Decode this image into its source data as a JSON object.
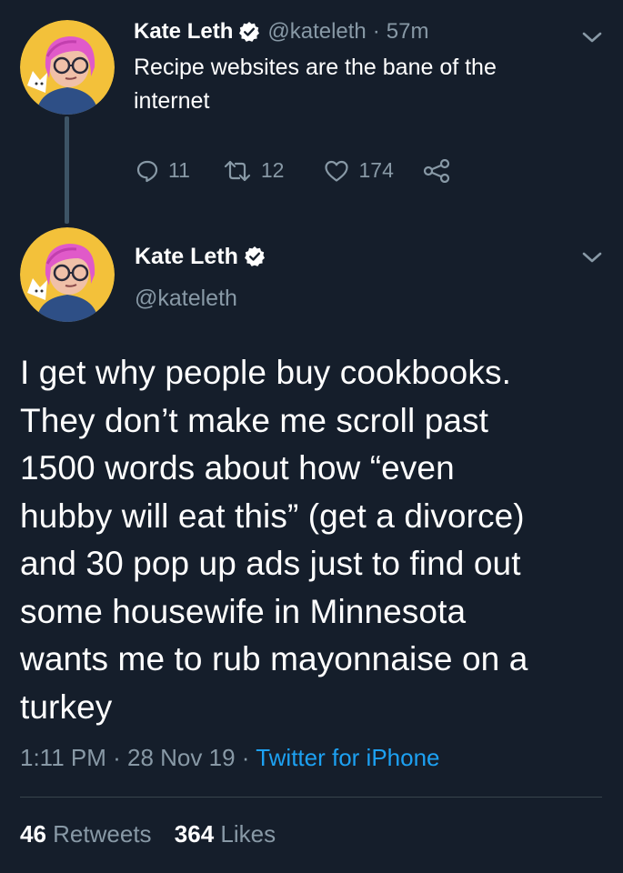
{
  "colors": {
    "background": "#151e2b",
    "text": "#ffffff",
    "muted": "#8899a6",
    "link": "#1da1f2",
    "verified": "#ffffff"
  },
  "tweet1": {
    "name": "Kate Leth",
    "handle": "@kateleth",
    "separator": "·",
    "time": "57m",
    "text_lines": [
      "Recipe websites are the bane of the",
      "internet"
    ],
    "actions": {
      "reply_icon": "reply-icon",
      "reply_count": "11",
      "retweet_icon": "retweet-icon",
      "retweet_count": "12",
      "like_icon": "heart-icon",
      "like_count": "174",
      "share_icon": "share-icon"
    }
  },
  "tweet2": {
    "name": "Kate Leth",
    "handle": "@kateleth",
    "text_lines": [
      "I get why people buy cookbooks.",
      "They don’t make me scroll past",
      "1500 words about how “even",
      "hubby will eat this” (get a divorce)",
      "and 30 pop up ads just to find out",
      "some housewife in Minnesota",
      "wants me to rub mayonnaise on a",
      "turkey"
    ],
    "time": "1:11 PM",
    "sep1": " · ",
    "date": "28 Nov 19",
    "sep2": " · ",
    "source": "Twitter for iPhone",
    "retweets_count": "46",
    "retweets_label": "Retweets",
    "likes_count": "364",
    "likes_label": "Likes"
  }
}
